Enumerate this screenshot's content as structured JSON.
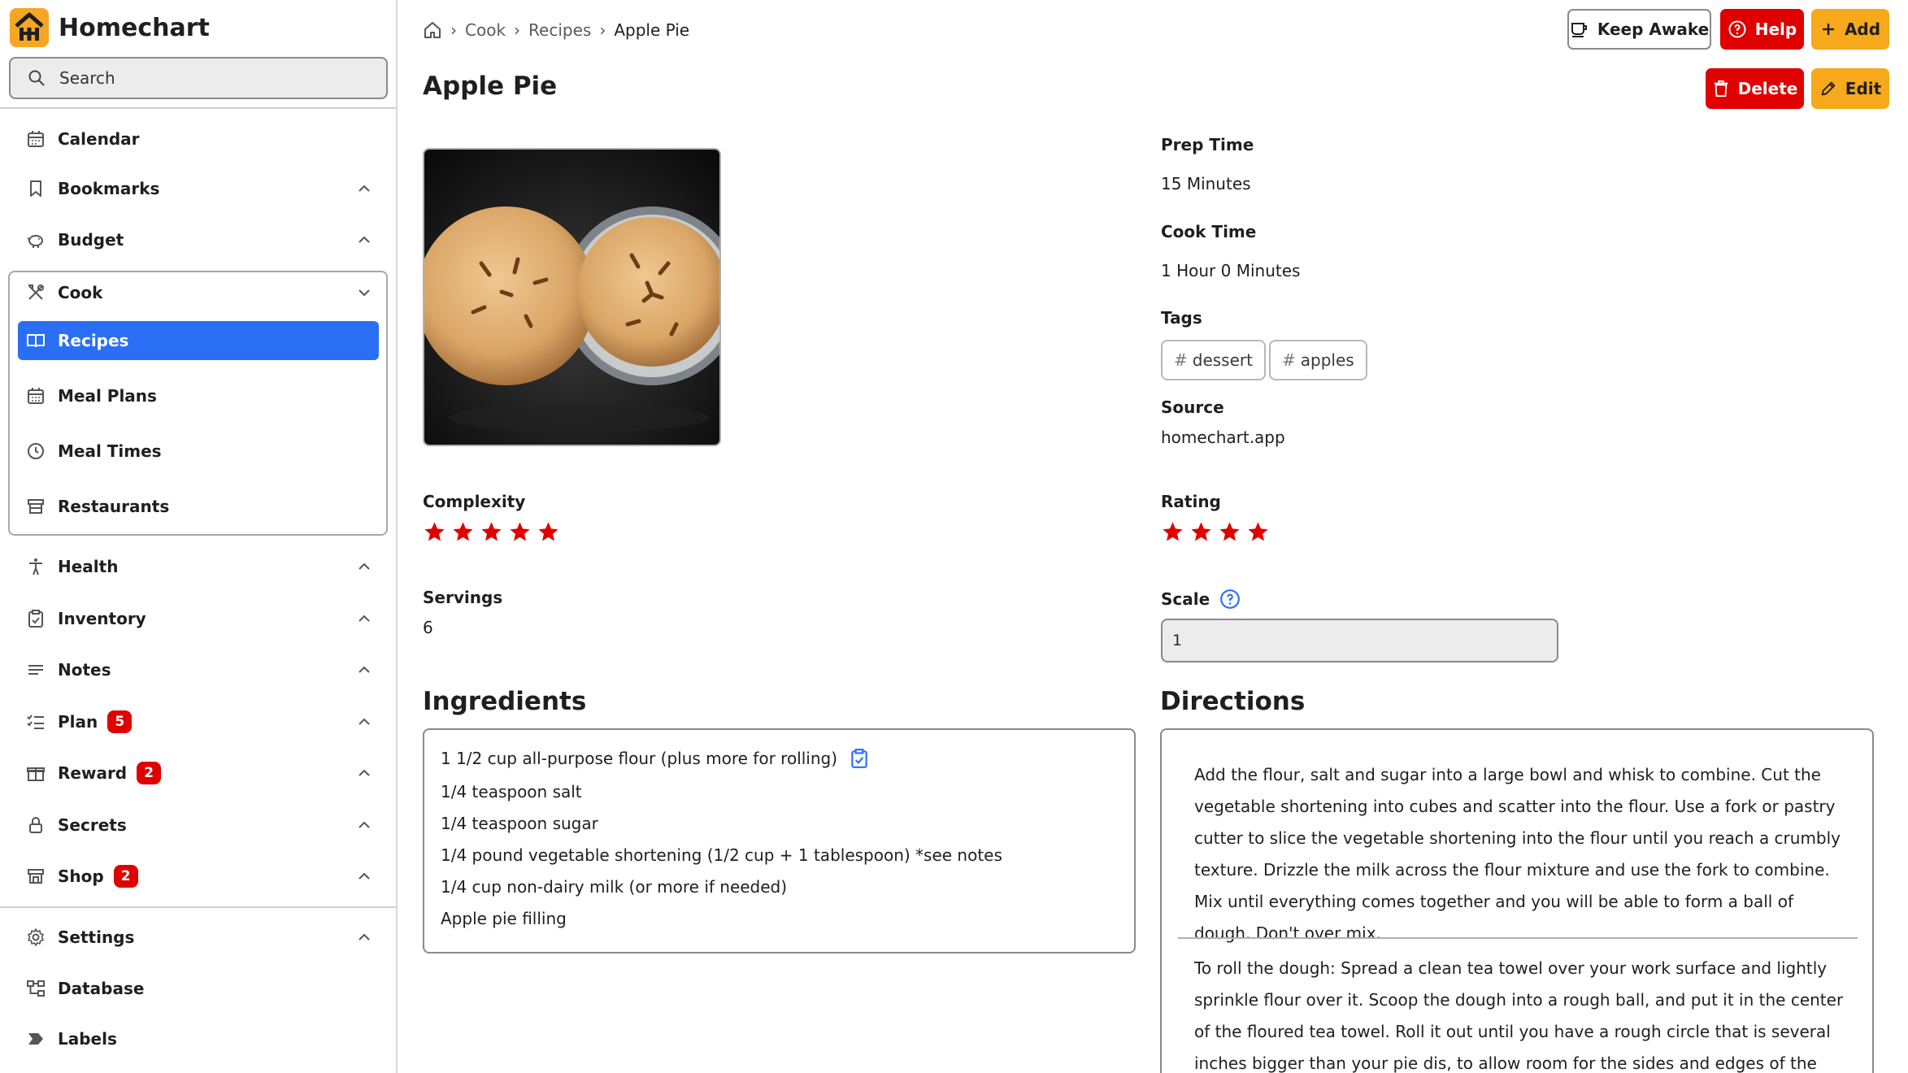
{
  "app": {
    "name": "Homechart"
  },
  "search": {
    "placeholder": "Search"
  },
  "sidebar": {
    "items": [
      {
        "label": "Calendar"
      },
      {
        "label": "Bookmarks"
      },
      {
        "label": "Budget"
      },
      {
        "label": "Cook"
      },
      {
        "label": "Recipes"
      },
      {
        "label": "Meal Plans"
      },
      {
        "label": "Meal Times"
      },
      {
        "label": "Restaurants"
      },
      {
        "label": "Health"
      },
      {
        "label": "Inventory"
      },
      {
        "label": "Notes"
      },
      {
        "label": "Plan",
        "badge": "5"
      },
      {
        "label": "Reward",
        "badge": "2"
      },
      {
        "label": "Secrets"
      },
      {
        "label": "Shop",
        "badge": "2"
      },
      {
        "label": "Settings"
      },
      {
        "label": "Database"
      },
      {
        "label": "Labels"
      }
    ]
  },
  "breadcrumb": {
    "items": [
      "Cook",
      "Recipes"
    ],
    "current": "Apple Pie"
  },
  "toolbar": {
    "keep_awake": "Keep Awake",
    "help": "Help",
    "add": "Add",
    "delete": "Delete",
    "edit": "Edit"
  },
  "recipe": {
    "title": "Apple Pie",
    "prep_time_label": "Prep Time",
    "prep_time": {
      "minutes_value": "15",
      "minutes_unit": "Minutes"
    },
    "cook_time_label": "Cook Time",
    "cook_time": {
      "hours_value": "1",
      "hours_unit": "Hour",
      "minutes_value": "0",
      "minutes_unit": "Minutes"
    },
    "tags_label": "Tags",
    "tags": [
      "dessert",
      "apples"
    ],
    "source_label": "Source",
    "source": "homechart.app",
    "complexity_label": "Complexity",
    "complexity": 5,
    "rating_label": "Rating",
    "rating": 4,
    "servings_label": "Servings",
    "servings": "6",
    "scale_label": "Scale",
    "scale": "1",
    "ingredients_heading": "Ingredients",
    "ingredients": [
      "1 1/2 cup all-purpose flour (plus more for rolling)",
      "1/4 teaspoon salt",
      "1/4 teaspoon sugar",
      "1/4 pound vegetable shortening (1/2 cup + 1 tablespoon) *see notes",
      "1/4 cup non-dairy milk (or more if needed)",
      "Apple pie filling"
    ],
    "directions_heading": "Directions",
    "directions": [
      "Add the flour, salt and sugar into a large bowl and whisk to combine. Cut the vegetable shortening into cubes and scatter into the flour. Use a fork or pastry cutter to slice the vegetable shortening into the flour until you reach a crumbly texture. Drizzle the milk across the flour mixture and use the fork to combine. Mix until everything comes together and you will be able to form a ball of dough. Don't over mix.",
      "To roll the dough: Spread a clean tea towel over your work surface and lightly sprinkle flour over it. Scoop the dough into a rough ball, and put it in the center of the floured tea towel. Roll it out until you have a rough circle that is several inches bigger than your pie dis, to allow room for the sides and edges of the crust."
    ]
  },
  "colors": {
    "accent": "#f7a81b",
    "danger": "#e00000",
    "active": "#2a6ff3",
    "star": "#e00000"
  },
  "icons": {
    "home": "home-icon",
    "search": "search-icon",
    "calendar": "calendar-icon",
    "bookmark": "bookmark-icon",
    "budget": "piggy-bank-icon",
    "cook": "utensils-icon",
    "recipes": "book-icon",
    "meal_plans": "calendar-grid-icon",
    "meal_times": "clock-icon",
    "restaurants": "storefront-icon",
    "health": "person-icon",
    "inventory": "clipboard-icon",
    "notes": "lines-icon",
    "plan": "checklist-icon",
    "reward": "gift-icon",
    "secrets": "lock-icon",
    "shop": "shop-icon",
    "settings": "gear-icon",
    "database": "database-icon",
    "labels": "label-icon",
    "star": "star-icon"
  }
}
